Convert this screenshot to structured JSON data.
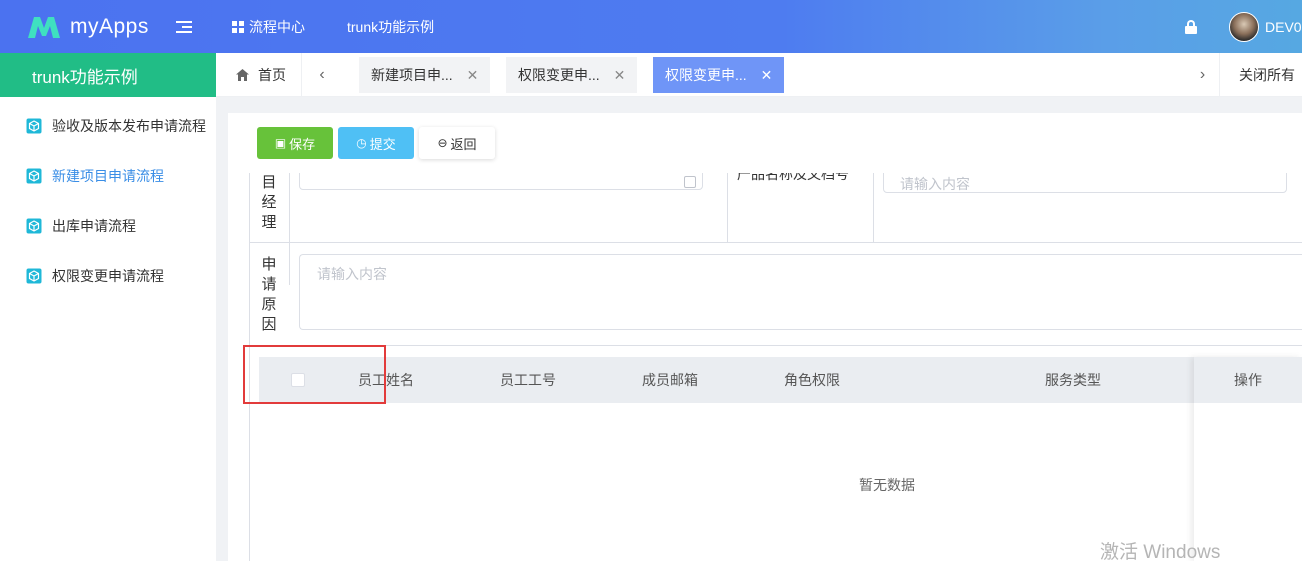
{
  "header": {
    "app_name": "myApps",
    "nav": [
      {
        "label": "流程中心"
      },
      {
        "label": "trunk功能示例"
      }
    ],
    "user_name": "DEV0"
  },
  "sidebar": {
    "title": "trunk功能示例",
    "items": [
      {
        "label": "验收及版本发布申请流程"
      },
      {
        "label": "新建项目申请流程"
      },
      {
        "label": "出库申请流程"
      },
      {
        "label": "权限变更申请流程"
      }
    ]
  },
  "tabs": {
    "home_label": "首页",
    "items": [
      {
        "label": "新建项目申..."
      },
      {
        "label": "权限变更申..."
      },
      {
        "label": "权限变更申..."
      }
    ],
    "close_all_label": "关闭所有"
  },
  "toolbar": {
    "save_label": "保存",
    "submit_label": "提交",
    "back_label": "返回"
  },
  "form": {
    "manager_label_tail": [
      "目",
      "经",
      "理"
    ],
    "field_cut_label": "产品名称及文档号",
    "field_cut_placeholder": "请输入内容",
    "reason_label": [
      "申",
      "请",
      "原",
      "因"
    ],
    "reason_placeholder": "请输入内容"
  },
  "table": {
    "columns": [
      "员工姓名",
      "员工工号",
      "成员邮箱",
      "角色权限",
      "服务类型",
      "操作"
    ],
    "empty_text": "暂无数据"
  },
  "watermark": "激活 Windows",
  "colors": {
    "header_gradient_start": "#4b72f0",
    "sidebar_header": "#21bd86",
    "active_tab": "#6f95f7",
    "save_button": "#67c23a",
    "submit_button": "#4fc0f5",
    "highlight": "#e23b3b"
  }
}
